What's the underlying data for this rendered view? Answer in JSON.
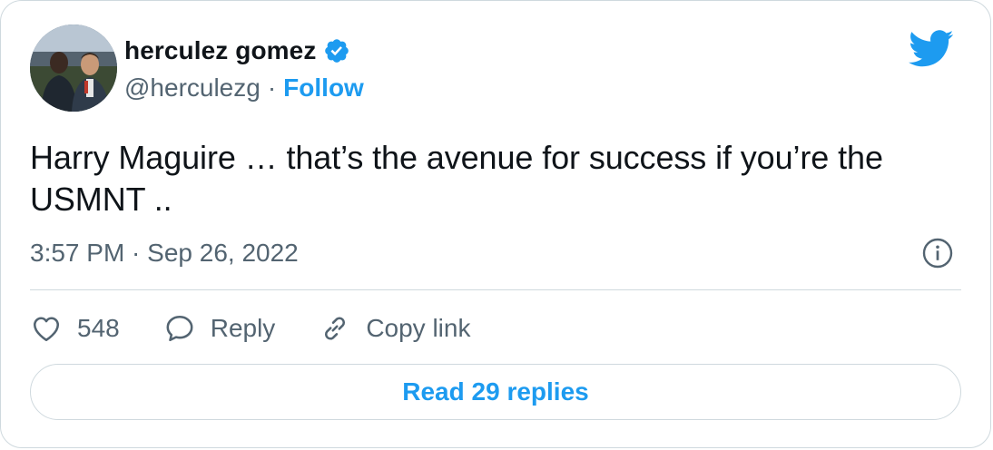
{
  "tweet": {
    "author": {
      "display_name": "herculez gomez",
      "handle": "@herculezg",
      "verified_icon": "verified-badge-icon",
      "avatar_alt": "profile photo"
    },
    "separator": "·",
    "follow_label": "Follow",
    "text_line1": "Harry Maguire … that’s the avenue for success if you’re the",
    "text_line2": "USMNT ..",
    "timestamp": "3:57 PM · Sep 26, 2022",
    "actions": {
      "like_count": "548",
      "reply_label": "Reply",
      "copy_link_label": "Copy link"
    },
    "read_replies_label": "Read 29 replies"
  },
  "icons": {
    "brand": "twitter-bird-icon",
    "info": "info-icon",
    "like": "heart-icon",
    "reply": "speech-bubble-icon",
    "copy": "link-icon"
  },
  "colors": {
    "accent": "#1d9bf0",
    "text": "#0f1419",
    "secondary": "#536471",
    "border": "#cfd9de"
  }
}
